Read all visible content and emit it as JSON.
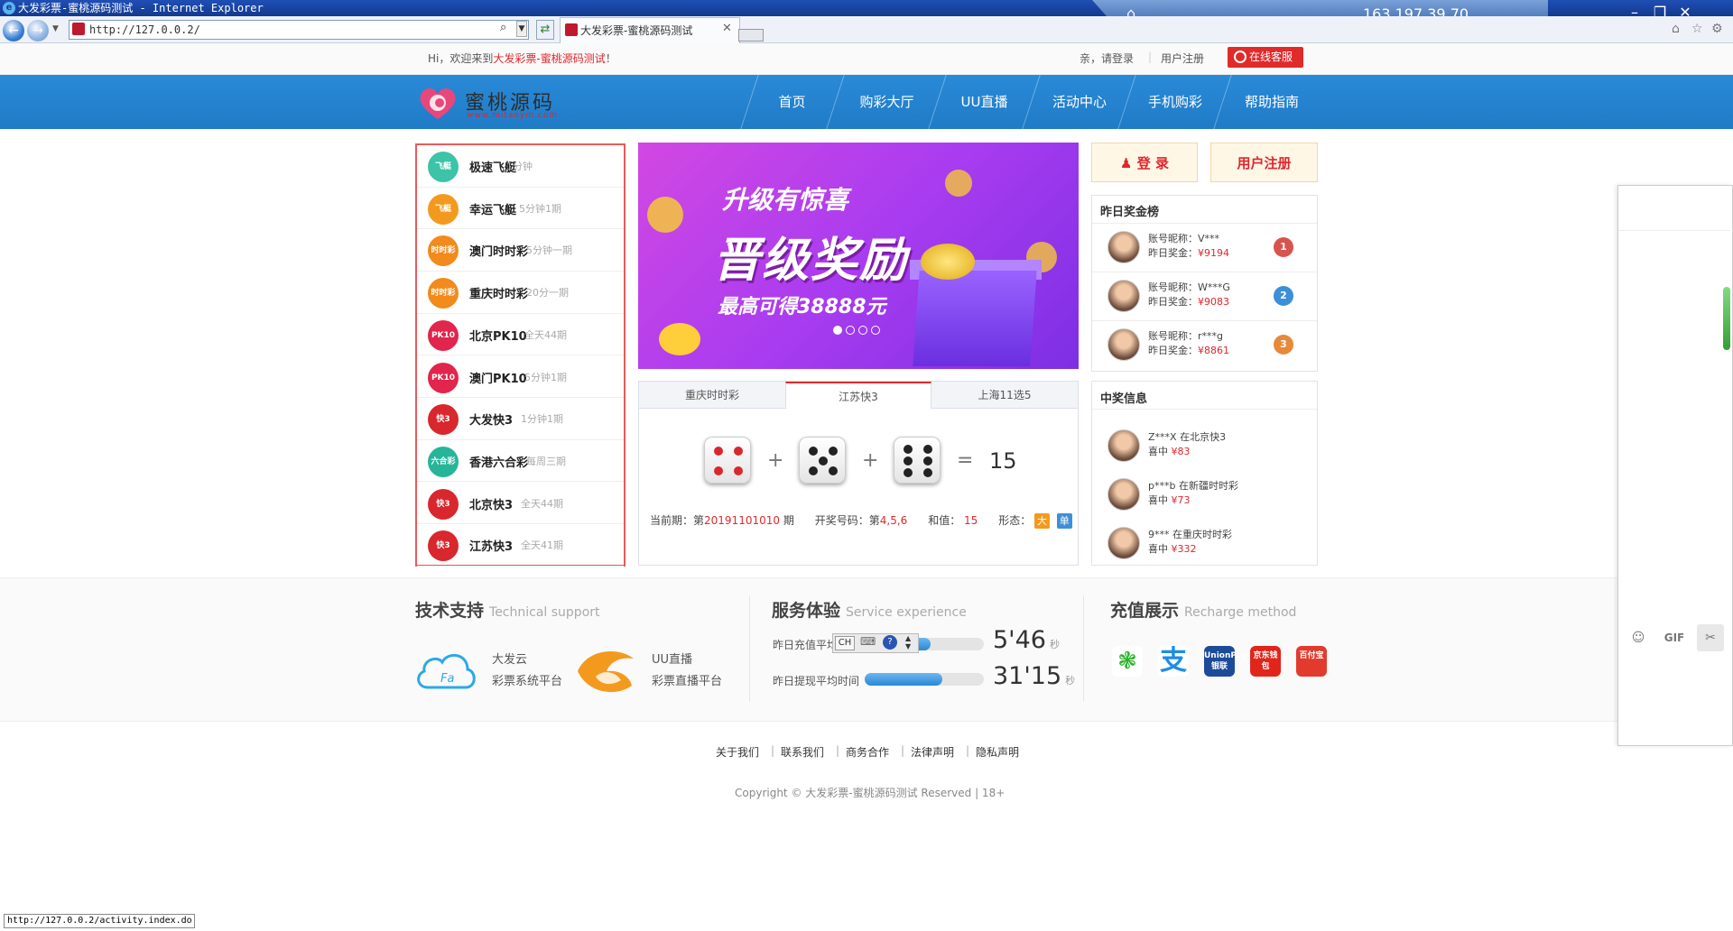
{
  "browser": {
    "window_title": "大发彩票-蜜桃源码测试 - Internet Explorer",
    "address": "http://127.0.0.2/",
    "tab_title": "大发彩票-蜜桃源码测试",
    "remote_ip": "163.197.39.70",
    "status_url": "http://127.0.0.2/activity.index.do"
  },
  "topbar": {
    "welcome_prefix": "Hi，欢迎来到",
    "welcome_site": "大发彩票-蜜桃源码测试",
    "welcome_suffix": "！",
    "login_hint": "亲，请登录",
    "register": "用户注册",
    "customer_service": "在线客服"
  },
  "logo": {
    "text": "蜜桃源码",
    "sub": "www.mitaoym.com"
  },
  "nav": [
    "首页",
    "购彩大厅",
    "UU直播",
    "活动中心",
    "手机购彩",
    "帮助指南"
  ],
  "lotteries": [
    {
      "name": "极速飞艇",
      "period": "1分钟",
      "icon": "飞艇",
      "color": "#3cc3a8"
    },
    {
      "name": "幸运飞艇",
      "period": "5分钟1期",
      "icon": "飞艇",
      "color": "#f39a1e"
    },
    {
      "name": "澳门时时彩",
      "period": "5分钟一期",
      "icon": "时时彩",
      "color": "#f28a1c"
    },
    {
      "name": "重庆时时彩",
      "period": "20分一期",
      "icon": "时时彩",
      "color": "#f28a1c"
    },
    {
      "name": "北京PK10",
      "period": "全天44期",
      "icon": "PK10",
      "color": "#e2254c"
    },
    {
      "name": "澳门PK10",
      "period": "5分钟1期",
      "icon": "PK10",
      "color": "#e2254c"
    },
    {
      "name": "大发快3",
      "period": "1分钟1期",
      "icon": "快3",
      "color": "#d9272e"
    },
    {
      "name": "香港六合彩",
      "period": "每周三期",
      "icon": "六合彩",
      "color": "#27b59a"
    },
    {
      "name": "北京快3",
      "period": "全天44期",
      "icon": "快3",
      "color": "#d9272e"
    },
    {
      "name": "江苏快3",
      "period": "全天41期",
      "icon": "快3",
      "color": "#d9272e"
    }
  ],
  "banner": {
    "line1": "升级有惊喜",
    "line2": "晋级奖励",
    "line3": "最高可得38888元",
    "slides": 4,
    "active_slide": 1
  },
  "dice": {
    "tabs": [
      "重庆时时彩",
      "江苏快3",
      "上海11选5"
    ],
    "active_tab": 1,
    "values": [
      4,
      5,
      6
    ],
    "sum": "15",
    "prev_label": "当前期：第",
    "prev_issue": "20191101010",
    "issue_suffix": "期",
    "open_label": "开奖号码：第",
    "open_nums": "4,5,6",
    "sum_label": "和值：",
    "sum_value": "15",
    "shape_label": "形态：",
    "tag_big": "大",
    "tag_odd": "单",
    "op_plus": "+",
    "op_eq": "="
  },
  "auth": {
    "login": "登 录",
    "register": "用户注册"
  },
  "winners": {
    "title": "昨日奖金榜",
    "account_label": "账号昵称：",
    "prize_label": "昨日奖金：",
    "items": [
      {
        "name": "V***",
        "prize": "¥9194",
        "rank": "1",
        "color": "#d9534f"
      },
      {
        "name": "W***G",
        "prize": "¥9083",
        "rank": "2",
        "color": "#3c8fd9"
      },
      {
        "name": "r***g",
        "prize": "¥8861",
        "rank": "3",
        "color": "#e8893a"
      }
    ]
  },
  "news": {
    "title": "中奖信息",
    "items": [
      {
        "text": "Z***X 在北京快3",
        "prize": "¥83"
      },
      {
        "text": "p***b 在新疆时时彩",
        "prize": "¥73"
      },
      {
        "text": "9*** 在重庆时时彩",
        "prize": "¥332"
      }
    ],
    "prize_prefix": "喜中"
  },
  "support": {
    "title": "技术支持",
    "title_en": "Technical support",
    "item1_name": "大发云",
    "item1_desc": "彩票系统平台",
    "item2_name": "UU直播",
    "item2_desc": "彩票直播平台"
  },
  "service": {
    "title": "服务体验",
    "title_en": "Service experience",
    "recharge_label": "昨日充值平均",
    "recharge_value": "5'46",
    "recharge_fill": 0.55,
    "withdraw_label": "昨日提现平均时间",
    "withdraw_value": "31'15",
    "withdraw_fill": 0.65,
    "unit": "秒",
    "ime_mode": "CH"
  },
  "recharge": {
    "title": "充值展示",
    "title_en": "Recharge method",
    "methods": [
      {
        "name": "wechat-pay",
        "label": "",
        "color": "#2bb32b"
      },
      {
        "name": "alipay",
        "label": "支",
        "color": "#1d8de8"
      },
      {
        "name": "unionpay",
        "label": "UnionPay 银联",
        "color": "#1c4b9a"
      },
      {
        "name": "jd-wallet",
        "label": "京东钱包",
        "color": "#e1251b"
      },
      {
        "name": "baidu-wallet",
        "label": "百付宝",
        "color": "#e23b2e"
      }
    ]
  },
  "footer": {
    "links": [
      "关于我们",
      "联系我们",
      "商务合作",
      "法律声明",
      "隐私声明"
    ],
    "copyright": "Copyright © 大发彩票-蜜桃源码测试 Reserved | 18+"
  },
  "chat_panel": {
    "gif": "GIF"
  }
}
